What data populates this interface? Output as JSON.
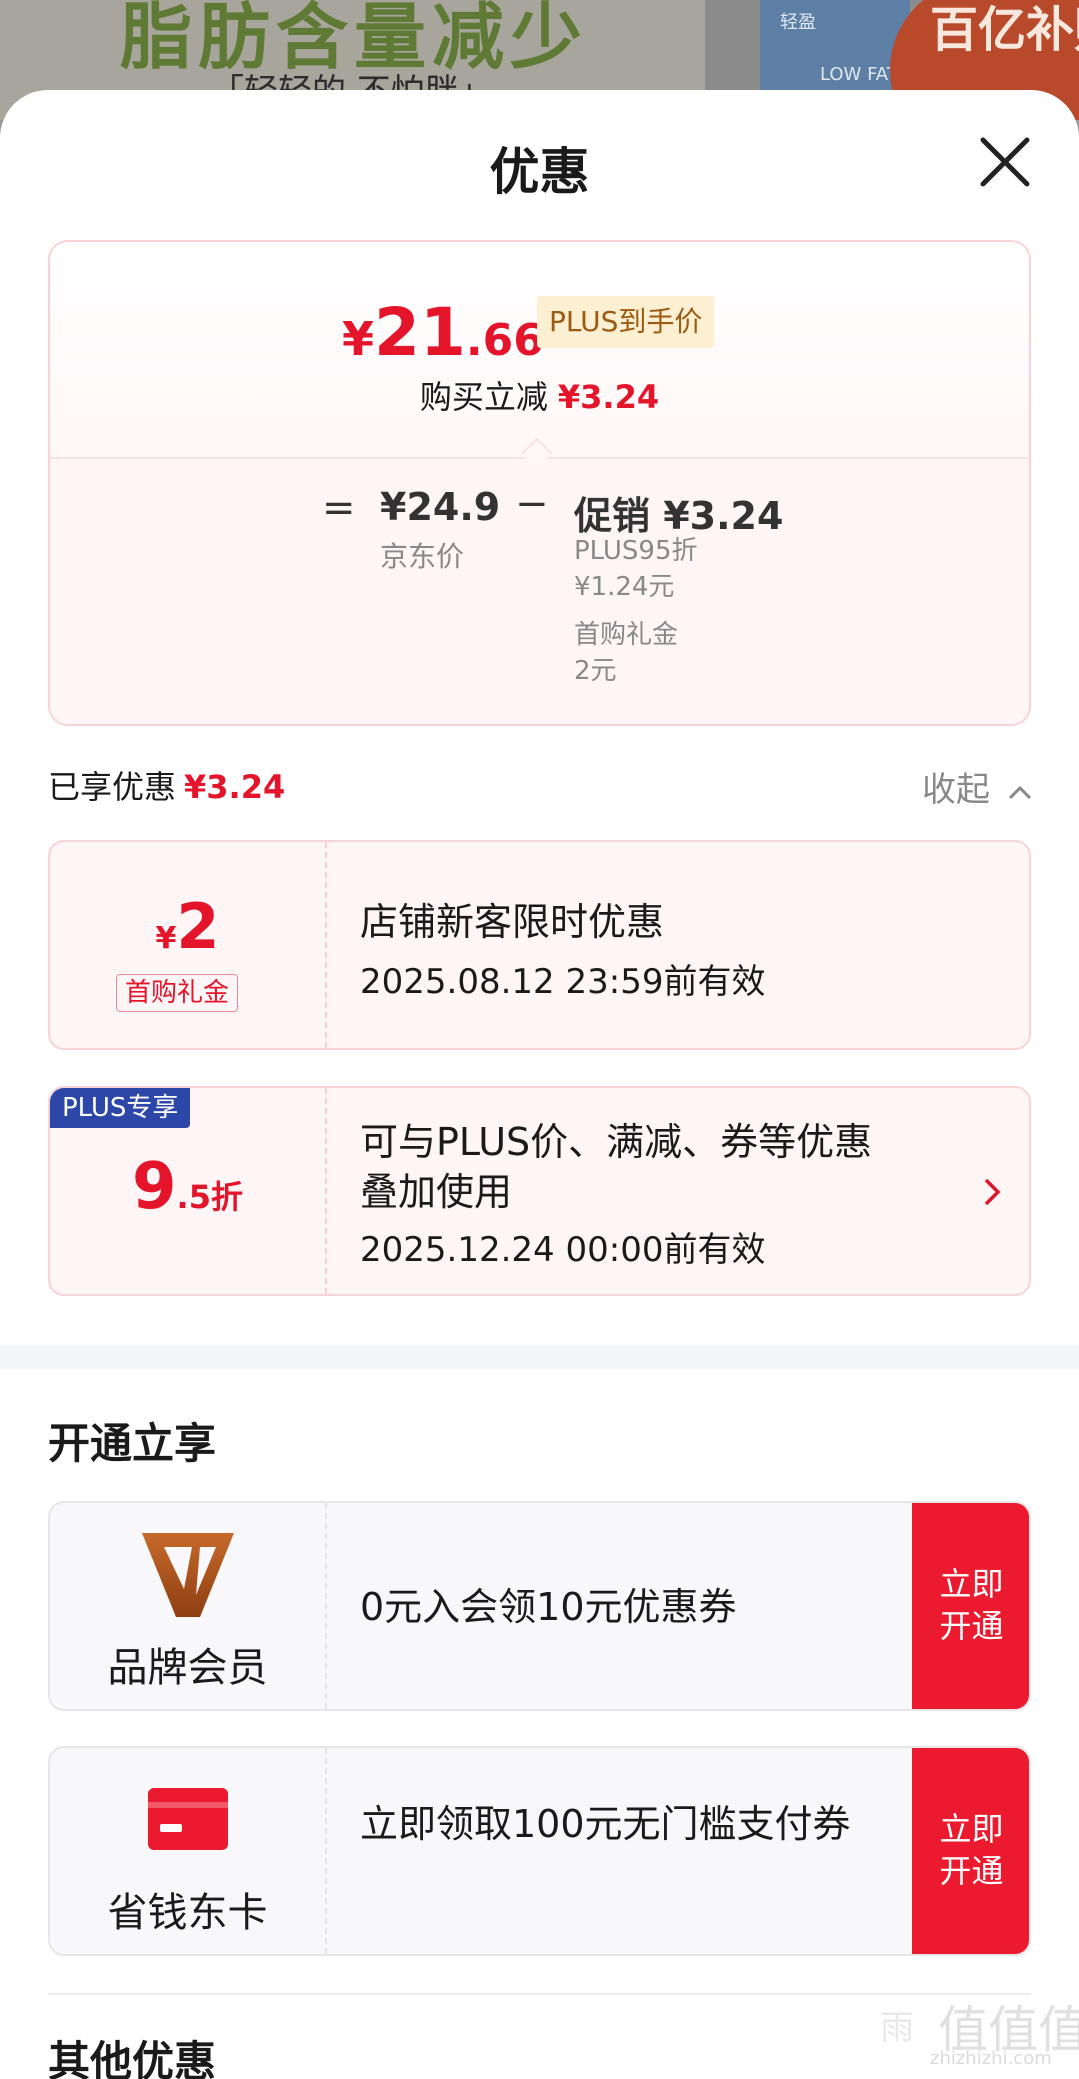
{
  "background": {
    "headline": "脂肪含量减少",
    "subline": "「轻轻的 不怕胖」",
    "pack_labels": [
      "轻盈",
      "LOW FAT"
    ],
    "badge_text": "百亿补贴"
  },
  "sheet": {
    "title": "优惠",
    "close_icon": "close-icon"
  },
  "price_card": {
    "currency": "¥",
    "price_int": "21",
    "price_dec": ".66",
    "plus_tag": "PLUS到手价",
    "reduce_label": "购买立减",
    "reduce_value": "¥3.24",
    "equals": "=",
    "jd_price": "¥24.9",
    "jd_price_label": "京东价",
    "minus": "−",
    "promo_value": "促销 ¥3.24",
    "promo_items": [
      {
        "name": "PLUS95折",
        "value": "¥1.24元"
      },
      {
        "name": "首购礼金",
        "value": "2元"
      }
    ]
  },
  "enjoyed": {
    "label": "已享优惠",
    "value": "¥3.24",
    "collapse_label": "收起"
  },
  "coupons": [
    {
      "currency": "¥",
      "amount": "2",
      "tag": "首购礼金",
      "title": "店铺新客限时优惠",
      "date": "2025.08.12 23:59前有效"
    },
    {
      "corner": "PLUS专享",
      "amount_int": "9",
      "amount_suffix": ".5折",
      "title_line1": "可与PLUS价、满减、券等优惠",
      "title_line2": "叠加使用",
      "date": "2025.12.24 00:00前有效"
    }
  ],
  "open_section": {
    "title": "开通立享",
    "items": [
      {
        "name": "品牌会员",
        "desc": "0元入会领10元优惠券",
        "button": "立即开通",
        "icon": "brand-v-icon"
      },
      {
        "name": "省钱东卡",
        "desc": "立即领取100元无门槛支付券",
        "button": "立即开通",
        "icon": "card-icon"
      }
    ]
  },
  "other_section": {
    "title": "其他优惠"
  },
  "watermark": {
    "big": "值值值",
    "small": "zhizhizhi.com",
    "left": "雨"
  },
  "colors": {
    "accent_red": "#e4142b",
    "button_red": "#ec1a2e",
    "plus_blue": "#2d47a8",
    "gold": "#9b5b12"
  }
}
